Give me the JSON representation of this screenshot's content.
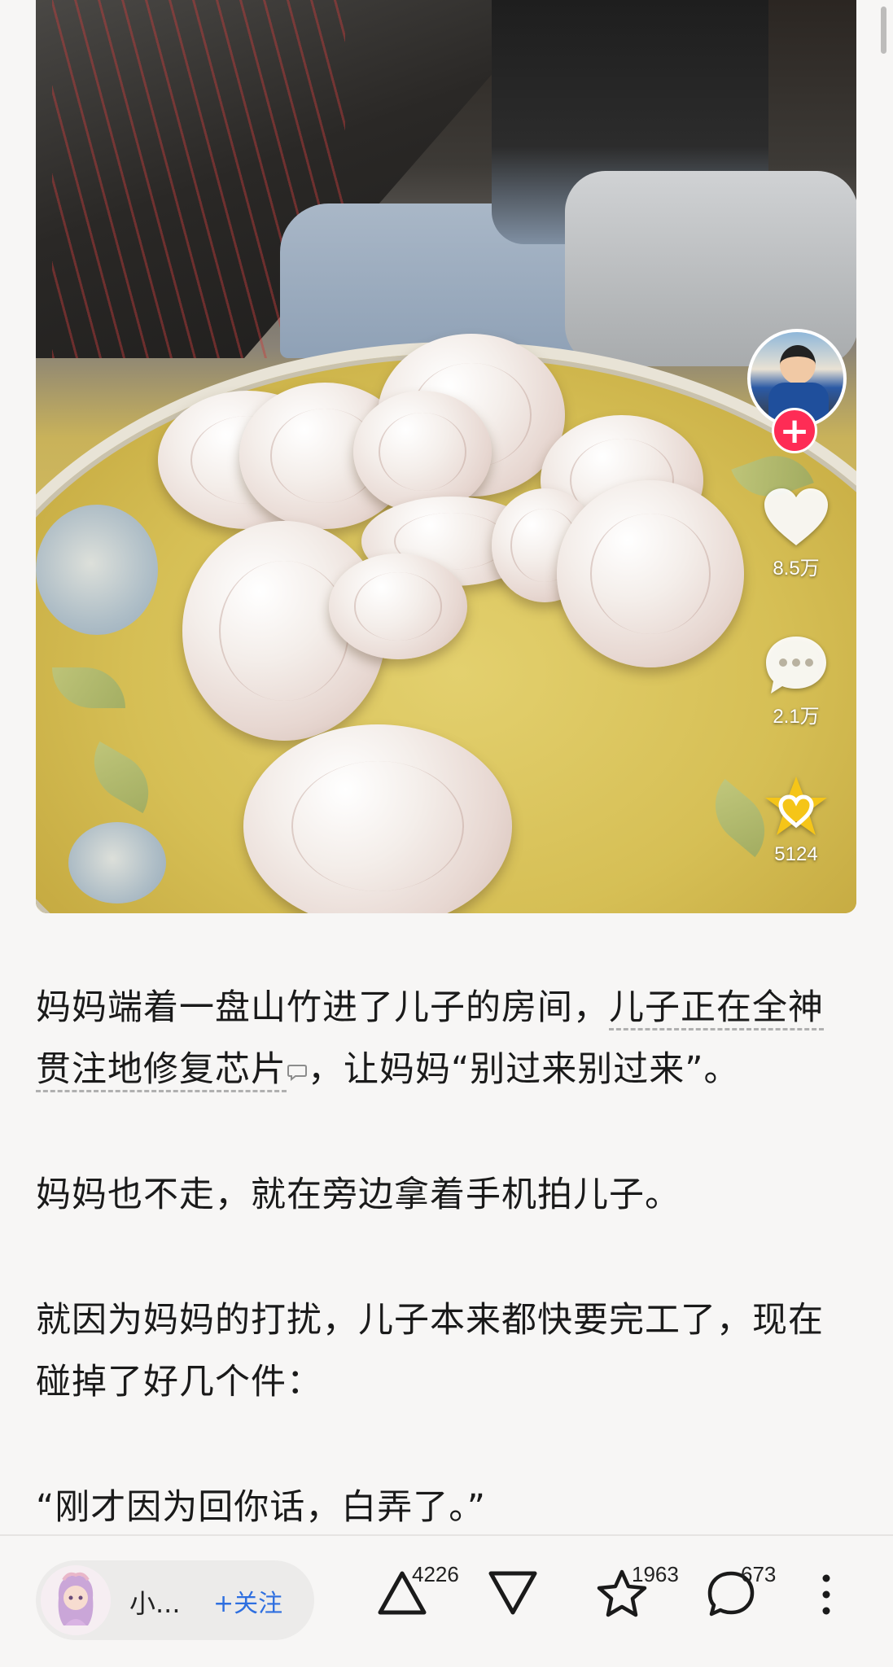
{
  "video": {
    "like_count": "8.5万",
    "comment_count": "2.1万",
    "favorite_count": "5124"
  },
  "article": {
    "p1_part1": "妈妈端着一盘山竹进了儿子的房间，",
    "p1_link": "儿子正在全神贯注地修复芯片",
    "p1_part2": "，让妈妈“别过来别过来”。",
    "p2": "妈妈也不走，就在旁边拿着手机拍儿子。",
    "p3": "就因为妈妈的打扰，儿子本来都快要完工了，现在碰掉了好几个件：",
    "p4": "“刚才因为回你话，白弄了。”"
  },
  "bottom_bar": {
    "author_name": "小...",
    "follow_label": "+关注",
    "upvote_count": "4226",
    "favorite_count": "1963",
    "comment_count": "673"
  },
  "colors": {
    "follow_blue": "#2e6fe0",
    "plus_red": "#fe2c55",
    "page_bg": "#f7f6f5"
  }
}
